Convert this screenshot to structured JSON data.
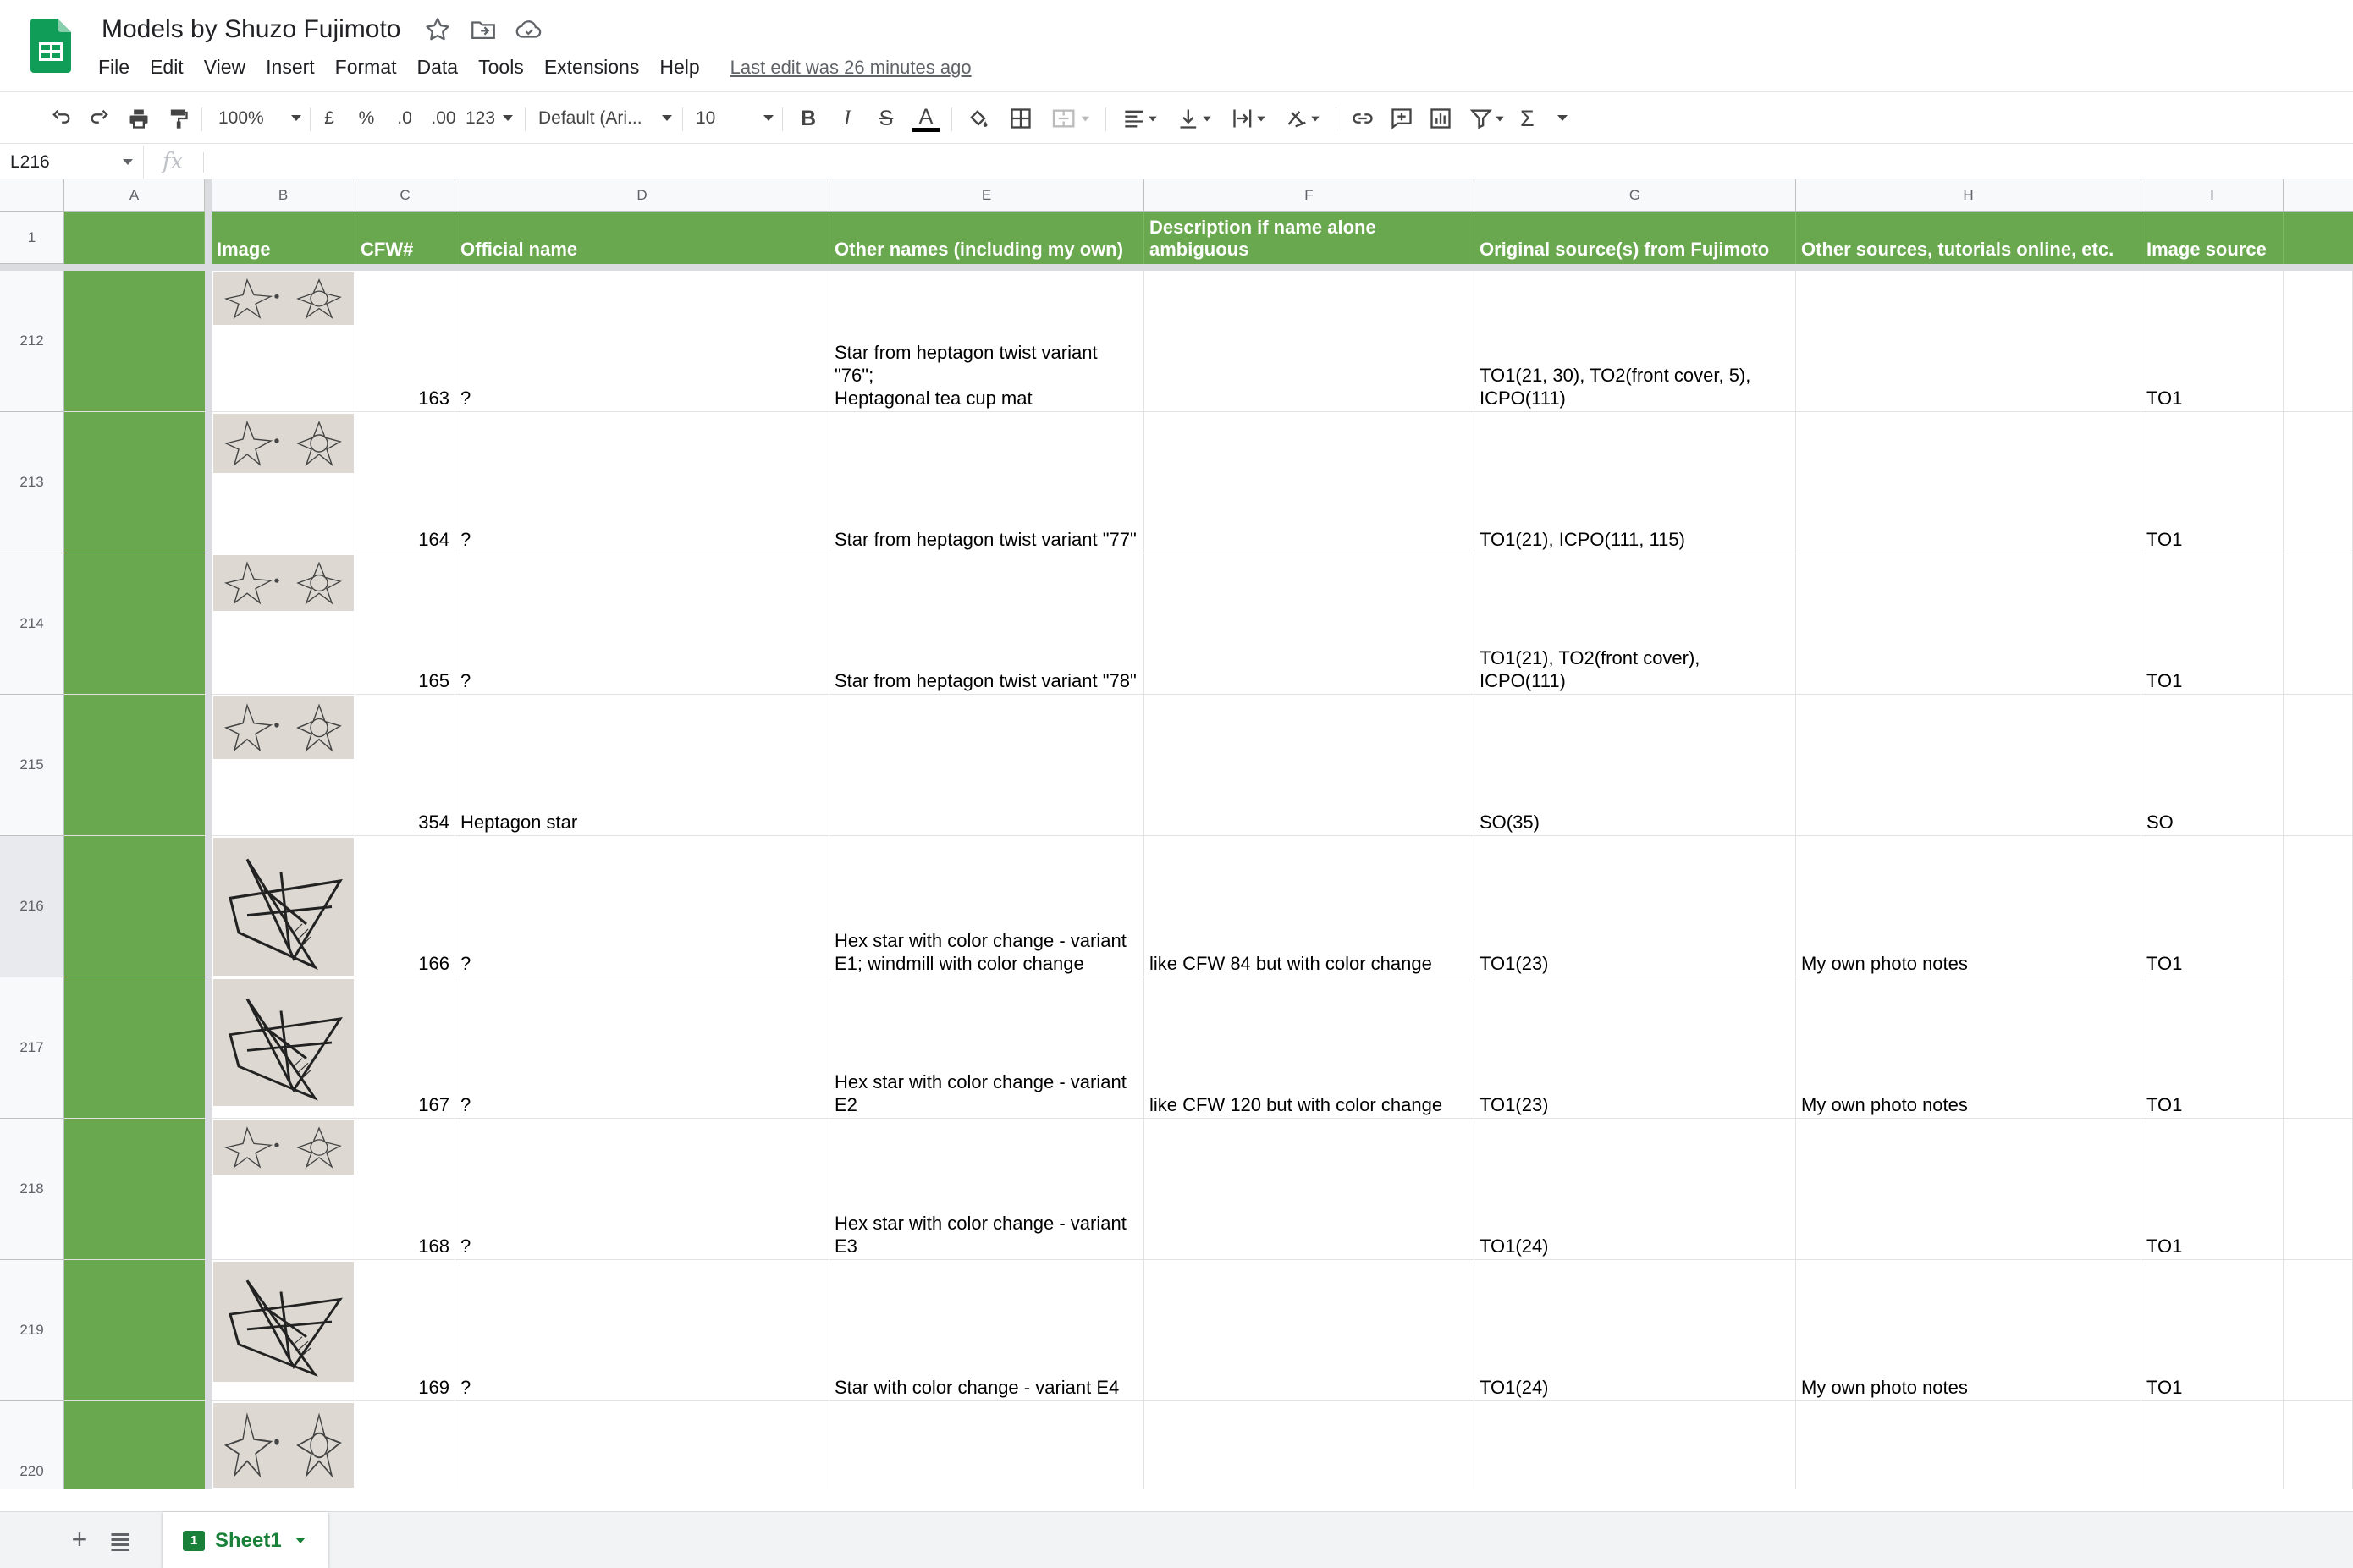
{
  "app": {
    "title": "Models by Shuzo Fujimoto",
    "last_edit": "Last edit was 26 minutes ago",
    "menu": [
      "File",
      "Edit",
      "View",
      "Insert",
      "Format",
      "Data",
      "Tools",
      "Extensions",
      "Help"
    ]
  },
  "toolbar": {
    "zoom": "100%",
    "currency": "£",
    "percent": "%",
    "decrease_decimal": ".0",
    "increase_decimal": ".00",
    "format_more": "123",
    "font": "Default (Ari...",
    "font_size": "10",
    "bold": "B",
    "italic": "I",
    "strike": "S",
    "text_color": "A",
    "sum": "Σ"
  },
  "formula_bar": {
    "name_box": "L216",
    "fx": "fx",
    "value": ""
  },
  "columns": [
    "A",
    "B",
    "C",
    "D",
    "E",
    "F",
    "G",
    "H",
    "I"
  ],
  "header_row": {
    "row_number": "1",
    "cells": [
      "",
      "Image",
      "CFW#",
      "Official name",
      "Other names (including my own)",
      "Description if name alone\nambiguous",
      "Original source(s) from Fujimoto",
      "Other sources, tutorials online, etc.",
      "Image source"
    ]
  },
  "rows": [
    {
      "row": "212",
      "cfw": "163",
      "official": "?",
      "other": "Star from heptagon twist variant \"76\";\nHeptagonal tea cup mat",
      "desc": "",
      "orig": "TO1(21, 30), TO2(front cover, 5),\nICPO(111)",
      "sources": "",
      "img": "TO1"
    },
    {
      "row": "213",
      "cfw": "164",
      "official": "?",
      "other": "Star from heptagon twist variant \"77\"",
      "desc": "",
      "orig": "TO1(21), ICPO(111, 115)",
      "sources": "",
      "img": "TO1"
    },
    {
      "row": "214",
      "cfw": "165",
      "official": "?",
      "other": "Star from heptagon twist variant \"78\"",
      "desc": "",
      "orig": "TO1(21), TO2(front cover), ICPO(111)",
      "sources": "",
      "img": "TO1"
    },
    {
      "row": "215",
      "cfw": "354",
      "official": "Heptagon star",
      "other": "",
      "desc": "",
      "orig": "SO(35)",
      "sources": "",
      "img": "SO"
    },
    {
      "row": "216",
      "cfw": "166",
      "official": "?",
      "other": "Hex star with color change - variant\nE1; windmill with color change",
      "desc": "like CFW 84 but with color change",
      "orig": "TO1(23)",
      "sources": "My own photo notes",
      "img": "TO1"
    },
    {
      "row": "217",
      "cfw": "167",
      "official": "?",
      "other": "Hex star with color change - variant\nE2",
      "desc": "like CFW 120 but with color change",
      "orig": "TO1(23)",
      "sources": "My own photo notes",
      "img": "TO1"
    },
    {
      "row": "218",
      "cfw": "168",
      "official": "?",
      "other": "Hex star with color change - variant\nE3",
      "desc": "",
      "orig": "TO1(24)",
      "sources": "",
      "img": "TO1"
    },
    {
      "row": "219",
      "cfw": "169",
      "official": "?",
      "other": "Star with color change - variant E4",
      "desc": "",
      "orig": "TO1(24)",
      "sources": "My own photo notes",
      "img": "TO1"
    },
    {
      "row": "220",
      "cfw": "",
      "official": "",
      "other": "",
      "desc": "",
      "orig": "",
      "sources": "",
      "img": ""
    }
  ],
  "sheet_tabs": {
    "add": "+",
    "active": {
      "index": "1",
      "name": "Sheet1"
    }
  },
  "colors": {
    "header_green": "#6aa84f",
    "sheets_green": "#188038"
  }
}
